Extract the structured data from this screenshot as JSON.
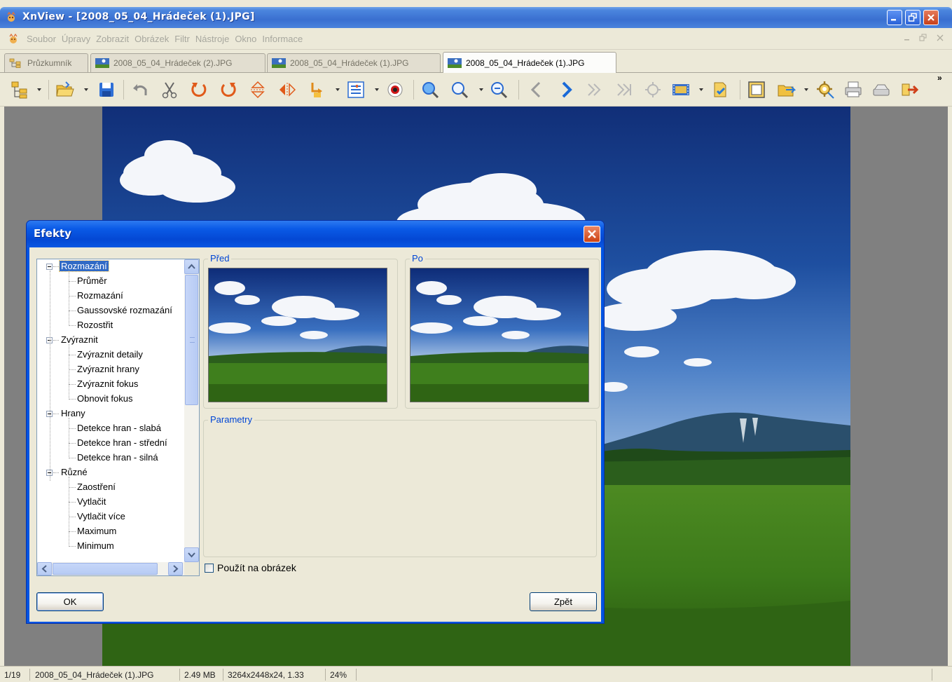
{
  "window": {
    "title": "XnView - [2008_05_04_Hrádeček (1).JPG]"
  },
  "menu": {
    "items": [
      "Soubor",
      "Úpravy",
      "Zobrazit",
      "Obrázek",
      "Filtr",
      "Nástroje",
      "Okno",
      "Informace"
    ]
  },
  "tabs": [
    {
      "label": "Průzkumník",
      "active": false
    },
    {
      "label": "2008_05_04_Hrádeček (2).JPG",
      "active": false
    },
    {
      "label": "2008_05_04_Hrádeček (1).JPG",
      "active": false
    },
    {
      "label": "2008_05_04_Hrádeček (1).JPG",
      "active": true
    }
  ],
  "toolbar": {
    "overflow_label": "»"
  },
  "dialog": {
    "title": "Efekty",
    "before_label": "Před",
    "after_label": "Po",
    "params_label": "Parametry",
    "apply_label": "Použít na obrázek",
    "apply_checked": false,
    "ok_label": "OK",
    "back_label": "Zpět",
    "tree": [
      {
        "label": "Rozmazání",
        "selected": true,
        "children": [
          "Průměr",
          "Rozmazání",
          "Gaussovské rozmazání",
          "Rozostřit"
        ]
      },
      {
        "label": "Zvýraznit",
        "selected": false,
        "children": [
          "Zvýraznit detaily",
          "Zvýraznit hrany",
          "Zvýraznit fokus",
          "Obnovit fokus"
        ]
      },
      {
        "label": "Hrany",
        "selected": false,
        "children": [
          "Detekce hran - slabá",
          "Detekce hran - střední",
          "Detekce hran - silná"
        ]
      },
      {
        "label": "Různé",
        "selected": false,
        "children": [
          "Zaostření",
          "Vytlačit",
          "Vytlačit více",
          "Maximum",
          "Minimum"
        ]
      }
    ]
  },
  "status": {
    "index": "1/19",
    "filename": "2008_05_04_Hrádeček (1).JPG",
    "size": "2.49 MB",
    "dimensions": "3264x2448x24, 1.33",
    "zoom": "24%"
  },
  "colors": {
    "titlebar": "#3a6fd0",
    "dialog_frame": "#0054e3",
    "selection": "#316ac5",
    "group_label": "#0046d5",
    "sky": "#2b5aa8",
    "grass": "#3f7a1e"
  }
}
